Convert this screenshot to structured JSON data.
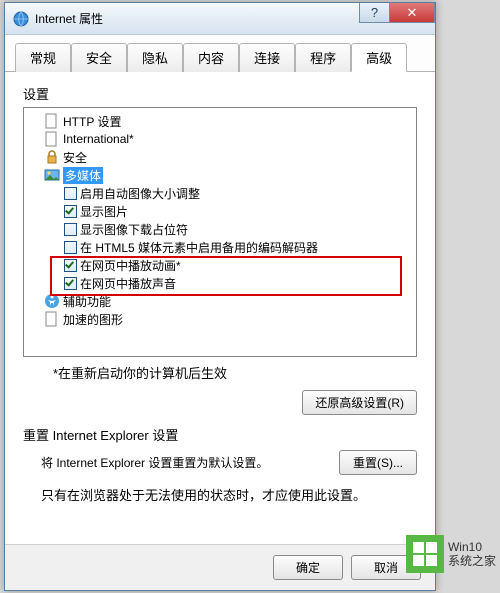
{
  "window": {
    "title": "Internet 属性",
    "help_glyph": "?",
    "close_glyph": "✕"
  },
  "tabs": [
    {
      "label": "常规"
    },
    {
      "label": "安全"
    },
    {
      "label": "隐私"
    },
    {
      "label": "内容"
    },
    {
      "label": "连接"
    },
    {
      "label": "程序"
    },
    {
      "label": "高级"
    }
  ],
  "active_tab": "高级",
  "settings_label": "设置",
  "tree": {
    "http": "HTTP 设置",
    "international": "International*",
    "security": "安全",
    "multimedia": "多媒体",
    "items": {
      "auto_resize": "启用自动图像大小调整",
      "show_images": "显示图片",
      "show_download_placeholder": "显示图像下载占位符",
      "html5_codec": "在 HTML5 媒体元素中启用备用的编码解码器",
      "play_animation": "在网页中播放动画*",
      "play_sound": "在网页中播放声音"
    },
    "accessibility": "辅助功能",
    "accel_graphics": "加速的图形"
  },
  "checks": {
    "auto_resize": false,
    "show_images": true,
    "show_download_placeholder": false,
    "html5_codec": false,
    "play_animation": true,
    "play_sound": true
  },
  "restart_note": "*在重新启动你的计算机后生效",
  "restore_btn": "还原高级设置(R)",
  "reset_group": "重置 Internet Explorer 设置",
  "reset_desc": "将 Internet Explorer 设置重置为默认设置。",
  "reset_btn": "重置(S)...",
  "reset_hint": "只有在浏览器处于无法使用的状态时，才应使用此设置。",
  "footer": {
    "ok": "确定",
    "cancel": "取消"
  },
  "watermark": {
    "line1": "Win10",
    "line2": "系统之家"
  }
}
